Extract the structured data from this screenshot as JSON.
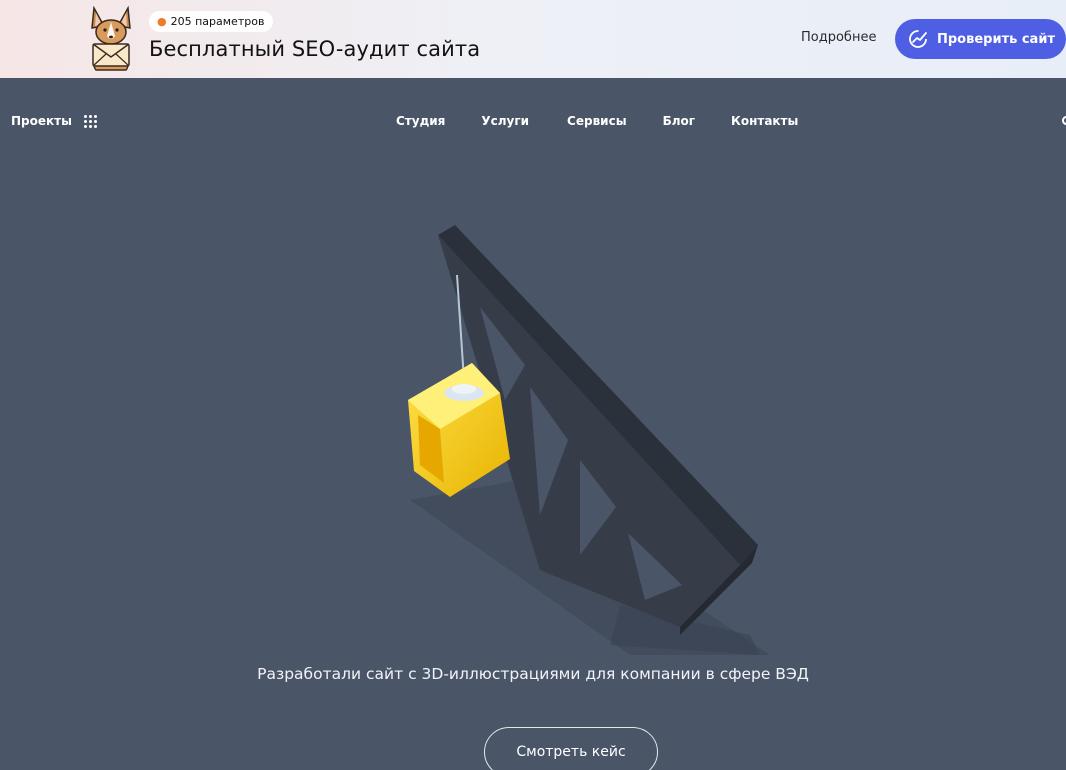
{
  "banner": {
    "badge_icon": "flame-icon",
    "badge_text": "205 параметров",
    "title": "Бесплатный SEO-аудит сайта",
    "more_link": "Подробнее",
    "check_button": "Проверить сайт",
    "accent_color": "#4f5fe4"
  },
  "nav": {
    "projects": "Проекты",
    "items": [
      "Студия",
      "Услуги",
      "Сервисы",
      "Блог",
      "Контакты"
    ]
  },
  "hero": {
    "caption": "Разработали сайт с 3D-иллюстрациями для компании в сфере ВЭД",
    "case_button": "Смотреть кейс",
    "background_color": "#4a5668"
  }
}
